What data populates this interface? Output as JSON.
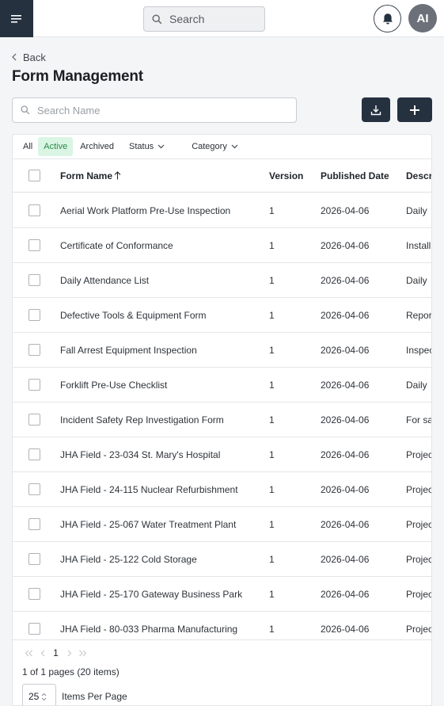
{
  "header": {
    "menu_icon": "hamburger-menu-icon",
    "search_placeholder": "Search",
    "notification_icon": "bell-icon",
    "avatar_initials": "AI"
  },
  "nav": {
    "back_label": "Back"
  },
  "page": {
    "title": "Form Management"
  },
  "toolbar": {
    "search_placeholder": "Search Name",
    "download_icon": "download-icon",
    "add_icon": "plus-icon"
  },
  "filters": {
    "tabs": [
      {
        "label": "All",
        "active": false
      },
      {
        "label": "Active",
        "active": true
      },
      {
        "label": "Archived",
        "active": false
      }
    ],
    "status_label": "Status",
    "category_label": "Category"
  },
  "table": {
    "columns": {
      "name": "Form Name",
      "version": "Version",
      "published": "Published Date",
      "description": "Description"
    },
    "rows": [
      {
        "name": "Aerial Work Platform Pre-Use Inspection",
        "version": "1",
        "published": "2026-04-06",
        "description": "Daily"
      },
      {
        "name": "Certificate of Conformance",
        "version": "1",
        "published": "2026-04-06",
        "description": "Install"
      },
      {
        "name": "Daily Attendance List",
        "version": "1",
        "published": "2026-04-06",
        "description": "Daily"
      },
      {
        "name": "Defective Tools & Equipment Form",
        "version": "1",
        "published": "2026-04-06",
        "description": "Report"
      },
      {
        "name": "Fall Arrest Equipment Inspection",
        "version": "1",
        "published": "2026-04-06",
        "description": "Inspect"
      },
      {
        "name": "Forklift Pre-Use Checklist",
        "version": "1",
        "published": "2026-04-06",
        "description": "Daily"
      },
      {
        "name": "Incident Safety Rep Investigation Form",
        "version": "1",
        "published": "2026-04-06",
        "description": "For safety"
      },
      {
        "name": "JHA Field - 23-034 St. Mary's Hospital",
        "version": "1",
        "published": "2026-04-06",
        "description": "Project"
      },
      {
        "name": "JHA Field - 24-115 Nuclear Refurbishment",
        "version": "1",
        "published": "2026-04-06",
        "description": "Project"
      },
      {
        "name": "JHA Field - 25-067 Water Treatment Plant",
        "version": "1",
        "published": "2026-04-06",
        "description": "Project"
      },
      {
        "name": "JHA Field - 25-122 Cold Storage",
        "version": "1",
        "published": "2026-04-06",
        "description": "Project"
      },
      {
        "name": "JHA Field - 25-170 Gateway Business Park",
        "version": "1",
        "published": "2026-04-06",
        "description": "Project"
      },
      {
        "name": "JHA Field - 80-033 Pharma Manufacturing",
        "version": "1",
        "published": "2026-04-06",
        "description": "Project"
      }
    ]
  },
  "pagination": {
    "current_page": "1",
    "pages_info": "1 of 1 pages (20 items)",
    "per_page_value": "25",
    "per_page_label": "Items Per Page"
  },
  "colors": {
    "dark_button": "#25313f",
    "active_tab_bg": "#daf5e3",
    "active_tab_text": "#2a8a4c"
  }
}
